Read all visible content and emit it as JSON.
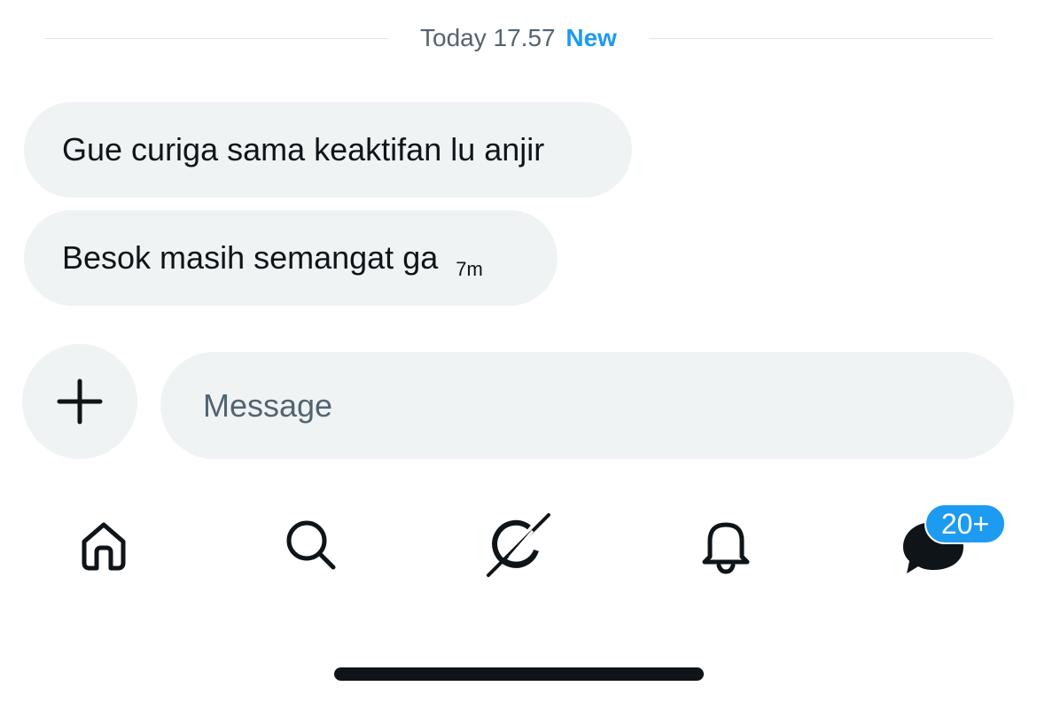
{
  "divider": {
    "date": "Today 17.57",
    "new_label": "New"
  },
  "messages": [
    {
      "text": "Gue curiga sama keaktifan lu anjir"
    },
    {
      "text": "Besok masih semangat ga",
      "time": "7m"
    }
  ],
  "composer": {
    "add_icon": "plus-icon",
    "placeholder": "Message"
  },
  "nav": {
    "items": [
      {
        "icon": "home-icon"
      },
      {
        "icon": "search-icon"
      },
      {
        "icon": "grok-icon"
      },
      {
        "icon": "bell-icon"
      },
      {
        "icon": "messages-icon",
        "badge": "20+"
      }
    ]
  },
  "colors": {
    "accent": "#1d9bf0",
    "bubble_bg": "#eff3f4",
    "text": "#0f1419",
    "secondary_text": "#536471"
  }
}
